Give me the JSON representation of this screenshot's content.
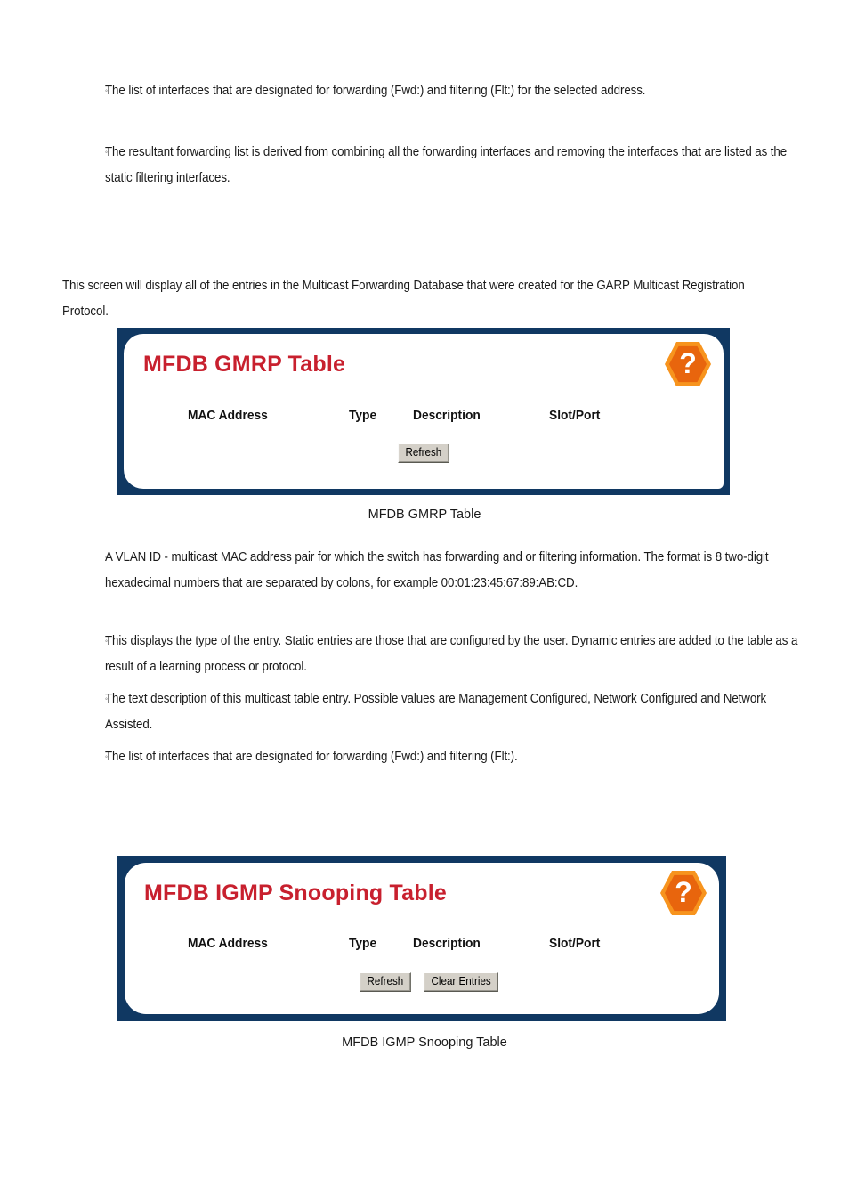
{
  "document": {
    "top_bullets": [
      {
        "marker": "◦",
        "lead_spaces": "                    ",
        "text": "The list of interfaces that are designated for forwarding (Fwd:) and filtering (Flt:) for the selected address."
      },
      {
        "marker": "◦",
        "lead_spaces": "                        ",
        "text": "The resultant forwarding list is derived from combining all the forwarding interfaces and removing the interfaces that are listed as the static filtering interfaces."
      }
    ],
    "intro_paragraph": "This screen will display all of the entries in the Multicast Forwarding Database that were created for the GARP Multicast Registration Protocol.",
    "mid_bullets": [
      {
        "marker": "◦",
        "lead_spaces": "                  ",
        "text": "A VLAN ID - multicast MAC address pair for which the switch has forwarding and or filtering information. The format is 8 two-digit hexadecimal numbers that are separated by colons, for example 00:01:23:45:67:89:AB:CD."
      },
      {
        "marker": "◦",
        "lead_spaces": "            ",
        "text": "This displays the type of the entry. Static entries are those that are configured by the user. Dynamic entries are added to the table as a result of a learning process or protocol."
      },
      {
        "marker": "◦",
        "lead_spaces": "                  ",
        "text": "The text description of this multicast table entry. Possible values are Management Configured, Network Configured and Network Assisted."
      },
      {
        "marker": "◦",
        "lead_spaces": "                 ",
        "text": "The list of interfaces that are designated for forwarding (Fwd:) and filtering (Flt:)."
      }
    ]
  },
  "panel_gmrp": {
    "title": "MFDB GMRP Table",
    "help_icon": "help-question-icon",
    "help_glyph": "?",
    "columns": [
      "MAC Address",
      "Type",
      "Description",
      "Slot/Port"
    ],
    "buttons": [
      "Refresh"
    ],
    "caption": "MFDB GMRP Table"
  },
  "panel_igmp": {
    "title": "MFDB IGMP Snooping Table",
    "help_icon": "help-question-icon",
    "help_glyph": "?",
    "columns": [
      "MAC Address",
      "Type",
      "Description",
      "Slot/Port"
    ],
    "buttons": [
      "Refresh",
      "Clear Entries"
    ],
    "caption": "MFDB IGMP Snooping Table"
  },
  "colors": {
    "panel_border": "#103862",
    "panel_background": "#ffffff",
    "title_red": "#c8202e",
    "help_orange_outer": "#f7941e",
    "help_orange_inner": "#e8650d",
    "button_face": "#d4d0c8"
  }
}
